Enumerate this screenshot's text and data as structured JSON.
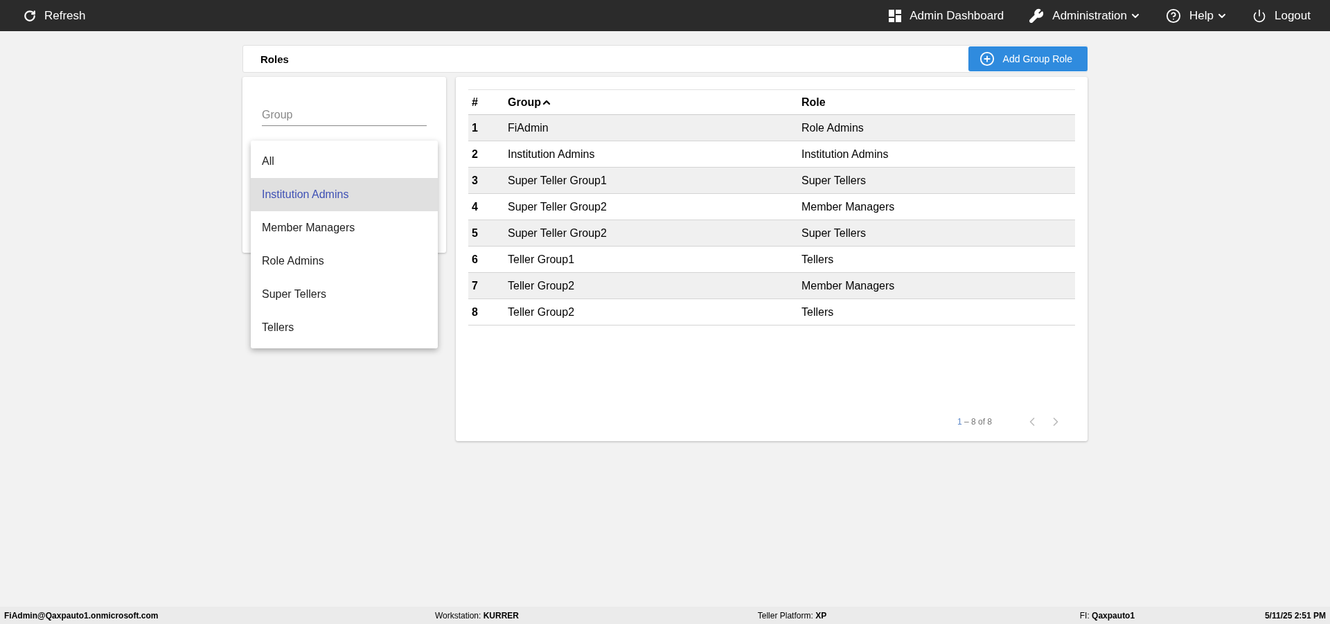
{
  "top_bar": {
    "refresh": "Refresh",
    "nav": [
      {
        "kind": "dashboard",
        "label": "Admin Dashboard",
        "caret": false
      },
      {
        "kind": "wrench",
        "label": "Administration",
        "caret": true
      },
      {
        "kind": "help",
        "label": "Help",
        "caret": true
      },
      {
        "kind": "power",
        "label": "Logout",
        "caret": false
      }
    ]
  },
  "header": {
    "title": "Roles",
    "add_button": "Add Group Role"
  },
  "filters": {
    "group_placeholder": "Group",
    "menu": [
      {
        "label": "All",
        "selected": false
      },
      {
        "label": "Institution Admins",
        "selected": true
      },
      {
        "label": "Member Managers",
        "selected": false
      },
      {
        "label": "Role Admins",
        "selected": false
      },
      {
        "label": "Super Tellers",
        "selected": false
      },
      {
        "label": "Tellers",
        "selected": false
      }
    ]
  },
  "table": {
    "columns": [
      {
        "label": "#",
        "sorted": false
      },
      {
        "label": "Group",
        "sorted": true
      },
      {
        "label": "Role",
        "sorted": false
      }
    ],
    "rows": [
      [
        "1",
        "FiAdmin",
        "Role Admins"
      ],
      [
        "2",
        "Institution Admins",
        "Institution Admins"
      ],
      [
        "3",
        "Super Teller Group1",
        "Super Tellers"
      ],
      [
        "4",
        "Super Teller Group2",
        "Member Managers"
      ],
      [
        "5",
        "Super Teller Group2",
        "Super Tellers"
      ],
      [
        "6",
        "Teller Group1",
        "Tellers"
      ],
      [
        "7",
        "Teller Group2",
        "Member Managers"
      ],
      [
        "8",
        "Teller Group2",
        "Tellers"
      ]
    ],
    "pagination": {
      "range_from": "1",
      "range_rest": "– 8 of 8"
    }
  },
  "status_bar": [
    "FiAdmin@Qaxpauto1.onmicrosoft.com",
    "Workstation: **KURRER**",
    "Teller Platform: **XP**",
    "FI: **Qaxpauto1**",
    "5/11/25 2:51 PM"
  ]
}
